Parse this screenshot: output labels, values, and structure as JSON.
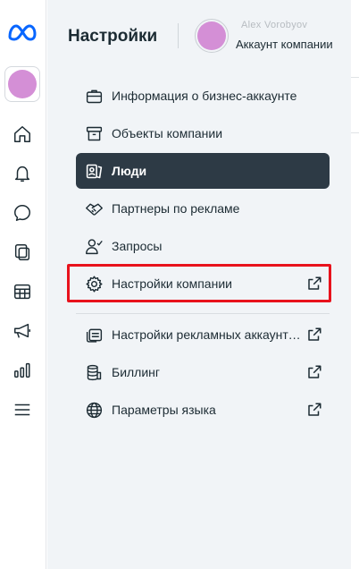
{
  "rail": {
    "logo": "meta-logo",
    "account_color": "#d48fd6",
    "icons": [
      "home-icon",
      "bell-icon",
      "chat-icon",
      "pages-icon",
      "table-icon",
      "megaphone-icon",
      "analytics-icon",
      "menu-icon"
    ]
  },
  "header": {
    "title": "Настройки",
    "account_name": "Alex Vorobyov",
    "account_subtitle": "Аккаунт компании",
    "avatar_color": "#d48fd6"
  },
  "menu": {
    "items": [
      {
        "label": "Информация о бизнес-аккаунте",
        "icon": "briefcase-icon"
      },
      {
        "label": "Объекты компании",
        "icon": "box-icon"
      },
      {
        "label": "Люди",
        "icon": "people-icon",
        "active": true
      },
      {
        "label": "Партнеры по рекламе",
        "icon": "handshake-icon"
      },
      {
        "label": "Запросы",
        "icon": "user-check-icon"
      },
      {
        "label": "Настройки компании",
        "icon": "gear-icon",
        "external": true,
        "highlighted": true
      },
      {
        "label": "Настройки рекламных аккаунтов",
        "icon": "ad-accounts-icon",
        "external": true
      },
      {
        "label": "Биллинг",
        "icon": "coins-icon",
        "external": true
      },
      {
        "label": "Параметры языка",
        "icon": "globe-icon",
        "external": true
      }
    ]
  },
  "colors": {
    "active_bg": "#2d3a45",
    "highlight": "#e8121c",
    "panel_bg": "#f1f4f7",
    "meta_blue": "#0866ff"
  }
}
